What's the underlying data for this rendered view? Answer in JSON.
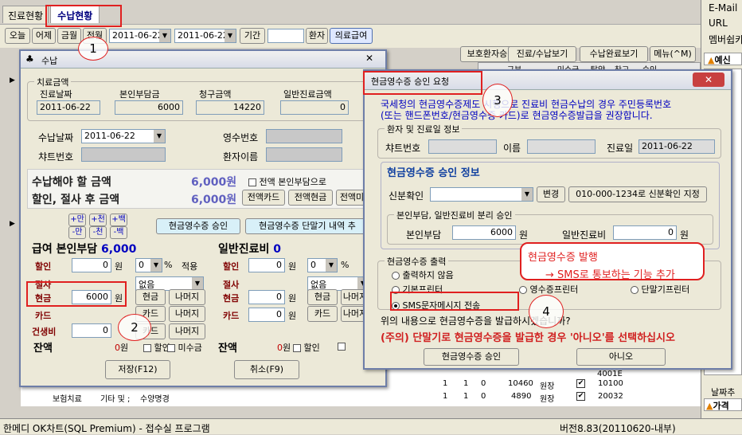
{
  "main": {
    "tabs": [
      "진료현황",
      "수납현황"
    ],
    "toolbar": {
      "today": "오늘",
      "yesterday": "어제",
      "this_month": "금월",
      "prev": "전월",
      "date_from": "2011-06-22",
      "date_to": "2011-06-22",
      "period": "기간",
      "patient": "환자",
      "insurance": "의료급여"
    },
    "topbtns": [
      "보호환자승인",
      "진료/수납보기",
      "수납완료보기",
      "메뉴(^M)"
    ],
    "col_heads": [
      "구분",
      "미수금",
      "탈약",
      "참고",
      "승인"
    ],
    "side": {
      "email": "E-Mail",
      "url": "URL",
      "membership": "멤버쉽카",
      "prepay": "예신",
      "date_add": "날짜추",
      "price": "가격"
    },
    "bottom_row": [
      "보험치료",
      "기타 및 ;",
      "수양명경"
    ],
    "grid_rows": [
      [
        "1",
        "1",
        "0",
        "10460",
        "원장",
        "10100"
      ],
      [
        "1",
        "1",
        "0",
        "4890",
        "원장",
        "20032"
      ]
    ],
    "partial_4": "4001E",
    "status": "한메디 OK차트(SQL Premium) - 접수실 프로그램",
    "version": "버전8.83(20110620-내부)"
  },
  "sunap": {
    "title": "수납",
    "treat_group": "치료금액",
    "heads": [
      "진료날짜",
      "본인부담금",
      "청구금액",
      "일반진료금액"
    ],
    "vals": [
      "2011-06-22",
      "6000",
      "14220",
      "0"
    ],
    "pay_date_label": "수납날짜",
    "pay_date": "2011-06-22",
    "receipt_label": "영수번호",
    "receipt": "",
    "chart_label": "챠트번호",
    "chart": "",
    "name_label": "환자이름",
    "name": "",
    "must_pay": "수납해야 할 금액",
    "must_pay_amt": "6,000원",
    "all_self": "전액 본인부담으로",
    "after_disc": "할인, 절사 후 금액",
    "after_disc_amt": "6,000원",
    "full_card": "전액카드",
    "full_cash": "전액현금",
    "full_more": "전액미",
    "plus": [
      "+만",
      "+천",
      "+백"
    ],
    "minus": [
      "-만",
      "-천",
      "-백"
    ],
    "cash_approve": "현금영수증 승인",
    "cash_terminal": "현금영수증 단말기 내역 추",
    "benefit_label": "급여 본인부담",
    "benefit_amt": "6,000",
    "general_label": "일반진료비",
    "general_amt": "0",
    "rows": [
      "할인",
      "절사",
      "현금",
      "카드",
      "건생비",
      "잔액"
    ],
    "won": "원",
    "pct": "%",
    "apply": "적용",
    "none": "없음",
    "cash_in": "6000",
    "zero": "0",
    "cash_btn": "현금",
    "rest_btn": "나머지",
    "card_btn": "카드",
    "discount": "할인",
    "unpaid": "미수금",
    "save": "저장(F12)",
    "cancel": "취소(F9)"
  },
  "approval": {
    "title": "현금영수증 승인 요청",
    "notice1": "국세청의 현금영수증제도 시행으로 진료비 현금수납의 경우 주민등록번호",
    "notice2": "(또는 핸드폰번호/현금영수증 카드)로 현금영수증발급을 권장합니다.",
    "patient_group": "환자 및 진료일 정보",
    "chart_label": "챠트번호",
    "name_label": "이름",
    "date_label": "진료일",
    "date": "2011-06-22",
    "info_title": "현금영수증 승인 정보",
    "id_label": "신분확인",
    "change": "변경",
    "id_btn": "010-000-1234로 신분확인 지정",
    "split_group": "본인부담, 일반진료비 분리 승인",
    "self_label": "본인부담",
    "self_val": "6000",
    "general_label": "일반진료비",
    "general_val": "0",
    "won": "원",
    "output_group": "현금영수증 출력",
    "opts": [
      "출력하지 않음",
      "기본프린터",
      "SMS문자메시지 전송",
      "영수증프린터",
      "단말기프린터"
    ],
    "question": "위의 내용으로 현금영수증을 발급하시겠습니까?",
    "warning": "(주의) 단말기로 현금영수증을 발급한 경우 '아니오'를 선택하십시오",
    "approve_btn": "현금영수증 승인",
    "no_btn": "아니오"
  },
  "annotation": {
    "line1": "현금영수증 발행",
    "line2": "→ SMS로 통보하는 기능 추가",
    "steps": [
      "1",
      "2",
      "3",
      "4"
    ]
  },
  "colors": {
    "red": "#e02020",
    "blue": "#0000c0",
    "maroon": "#800000"
  }
}
